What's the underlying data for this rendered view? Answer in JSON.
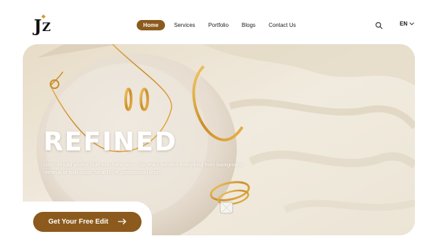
{
  "brand": {
    "logo_text": "JZ",
    "accent": "#8b5a1c"
  },
  "nav": {
    "items": [
      "Home",
      "Services",
      "Portfolio",
      "Blogs",
      "Contact Us"
    ],
    "active": "Home"
  },
  "header": {
    "search_icon": "search-icon",
    "language": "EN",
    "language_icon": "chevron-down-icon"
  },
  "hero": {
    "title": "REFINED",
    "description": "Don't let bad photos hide your hard work. Our team handles everything from background removal to final polish for a 100% professional finish.",
    "cta_label": "Get Your Free Edit",
    "cta_icon": "arrow-right-icon"
  }
}
